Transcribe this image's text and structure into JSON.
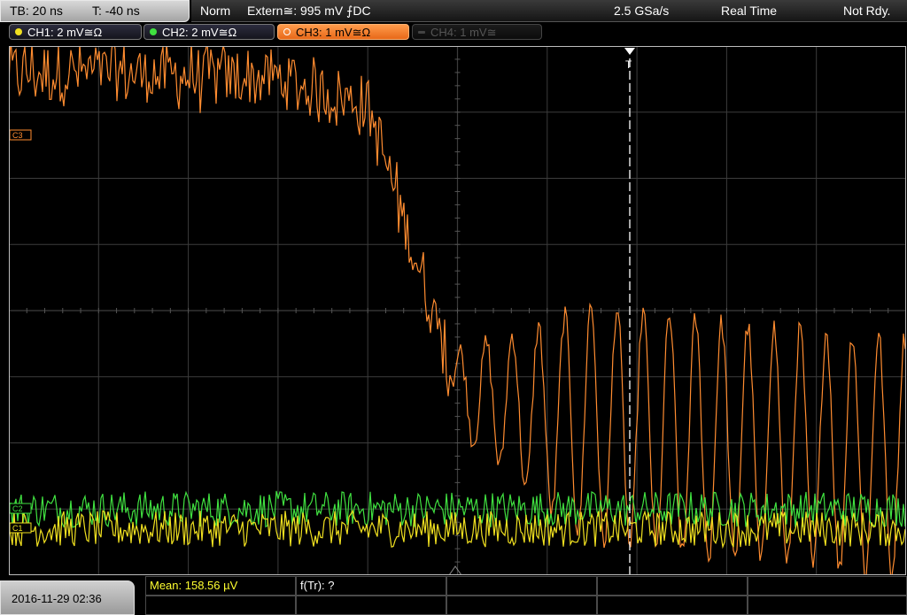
{
  "topbar": {
    "timebase": "TB: 20 ns",
    "trigger_time": "T: -40 ns",
    "mode": "Norm",
    "trigger_source": "Extern≅: 995 mV ⨍DC",
    "sample_rate": "2.5 GSa/s",
    "acq_mode": "Real Time",
    "status": "Not Rdy."
  },
  "channels": [
    {
      "label": "CH1: 2 mV≅Ω",
      "color": "#f0e020",
      "state": "on"
    },
    {
      "label": "CH2: 2 mV≅Ω",
      "color": "#40e040",
      "state": "on"
    },
    {
      "label": "CH3: 1 mV≅Ω",
      "color": "#ff9a3c",
      "state": "selected"
    },
    {
      "label": "CH4: 1 mV≅",
      "color": "#505050",
      "state": "off"
    }
  ],
  "markers": {
    "ch3": "C3",
    "ch2": "C2",
    "ch1": "C1",
    "trigger": "T"
  },
  "measurements": {
    "mean": "Mean: 158.56 µV",
    "rise_freq": "f(Tr): ?"
  },
  "footer": {
    "datetime": "2016-11-29 02:36"
  },
  "colors": {
    "ch1": "#f0e020",
    "ch2": "#40e040",
    "ch3": "#ff8c30",
    "grid": "#3c3c3c",
    "trigger_line": "#ffffff"
  },
  "chart_data": {
    "type": "line",
    "x_divisions": 10,
    "y_divisions": 8,
    "x_unit_per_div": "20 ns",
    "grid": true,
    "series": [
      {
        "name": "CH3",
        "description_level_divs": [
          3.6,
          3.6,
          3.55,
          3.5,
          3.1,
          -1.2,
          -1.6,
          -1.8,
          -2.0,
          -2.1,
          -2.2
        ],
        "noise": "high"
      },
      {
        "name": "CH2",
        "level_divs": -3.0,
        "noise": "medium"
      },
      {
        "name": "CH1",
        "level_divs": -3.3,
        "noise": "medium"
      }
    ]
  }
}
